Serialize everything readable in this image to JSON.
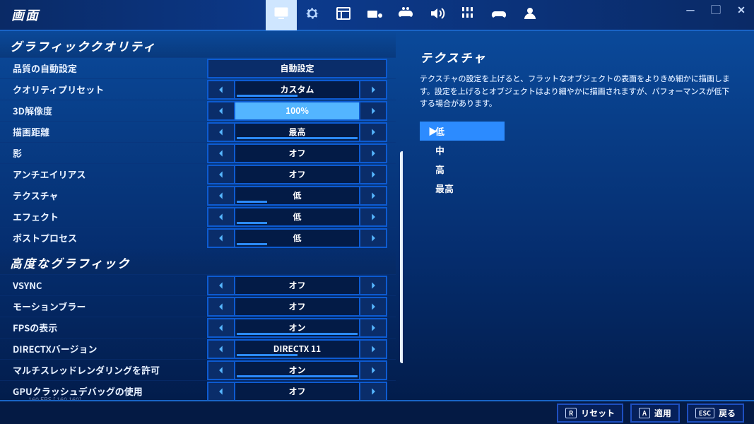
{
  "title": "画面",
  "tabs": [
    {
      "name": "display",
      "icon": "monitor"
    },
    {
      "name": "game",
      "icon": "gear"
    },
    {
      "name": "ui",
      "icon": "browser"
    },
    {
      "name": "kbm",
      "icon": "keyboard"
    },
    {
      "name": "controller",
      "icon": "controller"
    },
    {
      "name": "audio",
      "icon": "audio"
    },
    {
      "name": "touch",
      "icon": "touch"
    },
    {
      "name": "controller2",
      "icon": "gamepad"
    },
    {
      "name": "account",
      "icon": "person"
    }
  ],
  "active_tab": 0,
  "fps_counter": "160 FPS [ 160  160]",
  "sections": [
    {
      "header": "グラフィッククオリティ",
      "rows": [
        {
          "label": "品質の自動設定",
          "type": "button",
          "value": "自動設定",
          "bar_pct": 0
        },
        {
          "label": "クオリティプリセット",
          "type": "stepper",
          "value": "カスタム",
          "bar_pct": 50
        },
        {
          "label": "3D解像度",
          "type": "stepper",
          "value": "100%",
          "bar_pct": 100,
          "highlight": true
        },
        {
          "label": "描画距離",
          "type": "stepper",
          "value": "最高",
          "bar_pct": 100
        },
        {
          "label": "影",
          "type": "stepper",
          "value": "オフ",
          "bar_pct": 0
        },
        {
          "label": "アンチエイリアス",
          "type": "stepper",
          "value": "オフ",
          "bar_pct": 0
        },
        {
          "label": "テクスチャ",
          "type": "stepper",
          "value": "低",
          "bar_pct": 25
        },
        {
          "label": "エフェクト",
          "type": "stepper",
          "value": "低",
          "bar_pct": 25
        },
        {
          "label": "ポストプロセス",
          "type": "stepper",
          "value": "低",
          "bar_pct": 25
        }
      ]
    },
    {
      "header": "高度なグラフィック",
      "rows": [
        {
          "label": "VSYNC",
          "type": "stepper",
          "value": "オフ",
          "bar_pct": 0
        },
        {
          "label": "モーションブラー",
          "type": "stepper",
          "value": "オフ",
          "bar_pct": 0
        },
        {
          "label": "FPSの表示",
          "type": "stepper",
          "value": "オン",
          "bar_pct": 100
        },
        {
          "label": "DIRECTXバージョン",
          "type": "stepper",
          "value": "DIRECTX 11",
          "bar_pct": 50
        },
        {
          "label": "マルチスレッドレンダリングを許可",
          "type": "stepper",
          "value": "オン",
          "bar_pct": 100
        },
        {
          "label": "GPUクラッシュデバッグの使用",
          "type": "stepper",
          "value": "オフ",
          "bar_pct": 0
        }
      ]
    }
  ],
  "help": {
    "title": "テクスチャ",
    "desc": "テクスチャの設定を上げると、フラットなオブジェクトの表面をよりきめ細かに描画します。設定を上げるとオブジェクトはより細やかに描画されますが、パフォーマンスが低下する場合があります。",
    "options": [
      "低",
      "中",
      "高",
      "最高"
    ],
    "selected": 0
  },
  "footer": [
    {
      "key": "R",
      "label": "リセット"
    },
    {
      "key": "A",
      "label": "適用"
    },
    {
      "key": "ESC",
      "label": "戻る"
    }
  ]
}
